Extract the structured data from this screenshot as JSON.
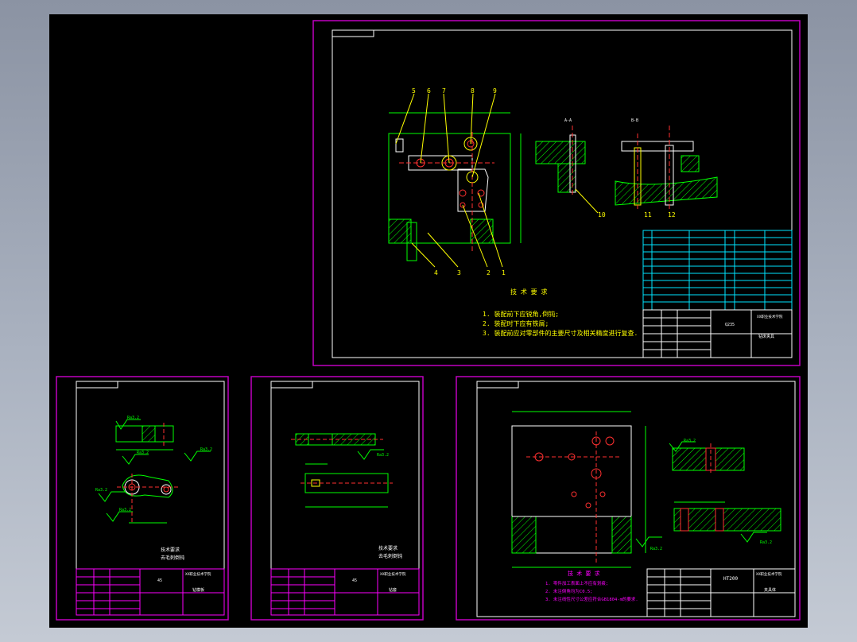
{
  "app": {
    "background": "#000000",
    "sheet_border_color": "#c000c0",
    "frame_color": "#ffffff",
    "outline_color": "#00ff00",
    "dimension_color": "#00ff00",
    "annotation_color": "#ffff00",
    "centerline_color": "#ff3030",
    "hatch_color": "#00ff00",
    "table_color": "#00e5ff"
  },
  "assembly": {
    "balloons": [
      "5",
      "6",
      "7",
      "8",
      "9",
      "4",
      "3",
      "2",
      "1",
      "10",
      "11",
      "12"
    ],
    "tech_req_title": "技 术 要 求",
    "tech_req": [
      "1. 装配前下应锐角,倒钝;",
      "2. 装配时下应有铁屑;",
      "3. 装配前应对零部件的主要尺寸及相关精度进行复查."
    ],
    "section_labels": [
      "A-A",
      "B-B"
    ],
    "title_block": {
      "school": "XX职业技术学院",
      "material": "Q235",
      "name": "钻床夹具"
    }
  },
  "part_small_1": {
    "roughness": [
      "Ra3.2",
      "Ra3.2",
      "Ra3.2",
      "Ra3.2",
      "Ra3.2"
    ],
    "tech_req_title": "技术要求",
    "tech_req_line": "去毛刺倒钝",
    "title_block": {
      "school": "XX职业技术学院",
      "name": "钻模板",
      "material": "45"
    }
  },
  "part_small_2": {
    "roughness": [
      "Ra3.2"
    ],
    "tech_req_title": "技术要求",
    "tech_req_line": "去毛刺倒钝",
    "title_block": {
      "school": "XX职业技术学院",
      "name": "钻套",
      "material": "45"
    }
  },
  "part_large": {
    "roughness": [
      "Ra3.2",
      "Ra3.2",
      "Ra3.2"
    ],
    "tech_req_title": "技 术 要 求",
    "tech_req": [
      "1. 零件加工表面上不应有划痕;",
      "2. 未注倒角均为C0.5;",
      "3. 未注线性尺寸公差应符合GB1804-m的要求."
    ],
    "material": "HT200",
    "title_block": {
      "school": "XX职业技术学院",
      "name": "夹具体"
    }
  }
}
